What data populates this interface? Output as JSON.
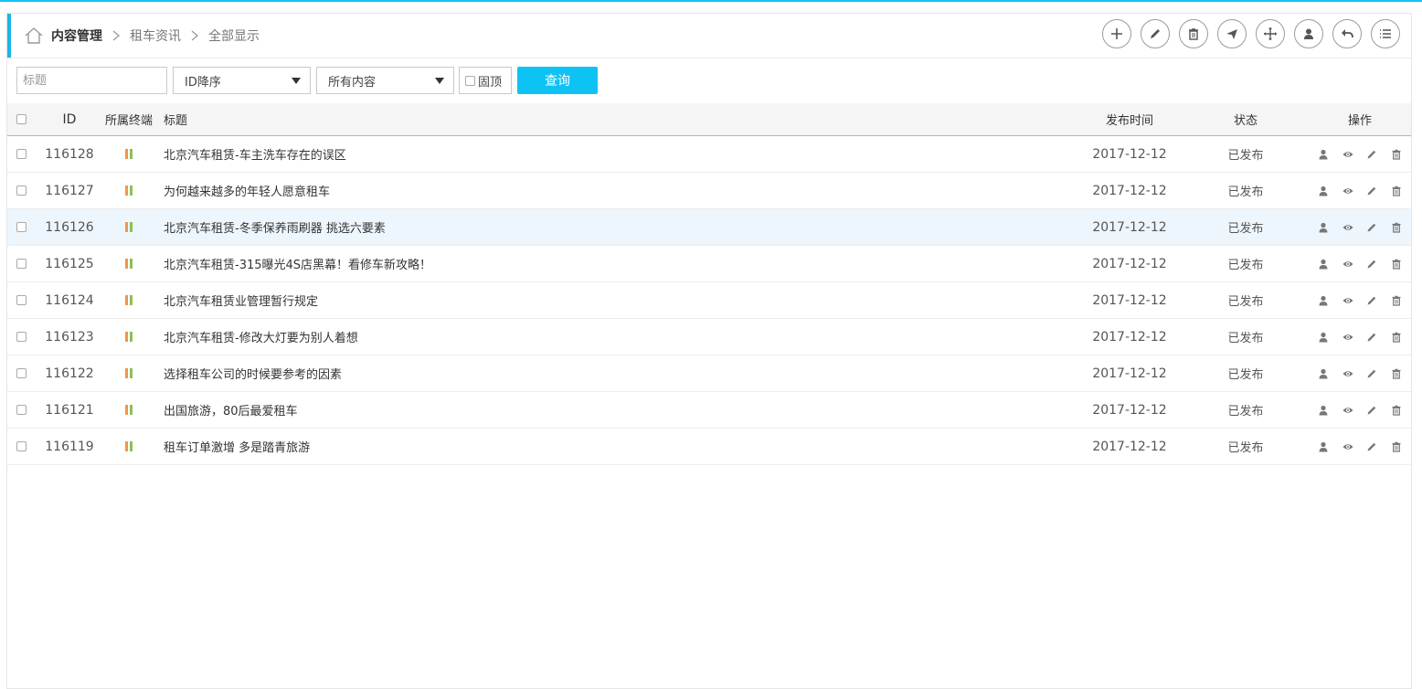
{
  "breadcrumb": {
    "home_icon": "home-icon",
    "items": [
      {
        "label": "内容管理"
      },
      {
        "label": "租车资讯"
      },
      {
        "label": "全部显示"
      }
    ]
  },
  "toolbar": {
    "buttons": [
      {
        "name": "add-button",
        "icon": "plus-icon"
      },
      {
        "name": "edit-button",
        "icon": "pencil-icon"
      },
      {
        "name": "delete-button",
        "icon": "trash-icon"
      },
      {
        "name": "publish-button",
        "icon": "send-icon"
      },
      {
        "name": "move-button",
        "icon": "move-icon"
      },
      {
        "name": "user-button",
        "icon": "user-icon"
      },
      {
        "name": "back-button",
        "icon": "undo-icon"
      },
      {
        "name": "list-button",
        "icon": "list-icon"
      }
    ]
  },
  "filters": {
    "title_placeholder": "标题",
    "title_value": "",
    "sort_selected": "ID降序",
    "content_selected": "所有内容",
    "pin_label": "固顶",
    "query_label": "查询"
  },
  "table": {
    "headers": {
      "id": "ID",
      "terminal": "所属终端",
      "title": "标题",
      "date": "发布时间",
      "status": "状态",
      "ops": "操作"
    },
    "rows": [
      {
        "id": "116128",
        "title": "北京汽车租赁-车主洗车存在的误区",
        "date": "2017-12-12",
        "status": "已发布"
      },
      {
        "id": "116127",
        "title": "为何越来越多的年轻人愿意租车",
        "date": "2017-12-12",
        "status": "已发布"
      },
      {
        "id": "116126",
        "title": "北京汽车租赁-冬季保养雨刷器 挑选六要素",
        "date": "2017-12-12",
        "status": "已发布"
      },
      {
        "id": "116125",
        "title": "北京汽车租赁-315曝光4S店黑幕！看修车新攻略！",
        "date": "2017-12-12",
        "status": "已发布"
      },
      {
        "id": "116124",
        "title": "北京汽车租赁业管理暂行规定",
        "date": "2017-12-12",
        "status": "已发布"
      },
      {
        "id": "116123",
        "title": "北京汽车租赁-修改大灯要为别人着想",
        "date": "2017-12-12",
        "status": "已发布"
      },
      {
        "id": "116122",
        "title": "选择租车公司的时候要参考的因素",
        "date": "2017-12-12",
        "status": "已发布"
      },
      {
        "id": "116121",
        "title": "出国旅游，80后最爱租车",
        "date": "2017-12-12",
        "status": "已发布"
      },
      {
        "id": "116119",
        "title": "租车订单激增 多是踏青旅游",
        "date": "2017-12-12",
        "status": "已发布"
      }
    ],
    "highlighted_row_index": 2
  },
  "colors": {
    "accent": "#0ec3f4",
    "terminal_pc": "#f0954d",
    "terminal_mobile": "#8cc152",
    "icon_gray": "#666666"
  }
}
